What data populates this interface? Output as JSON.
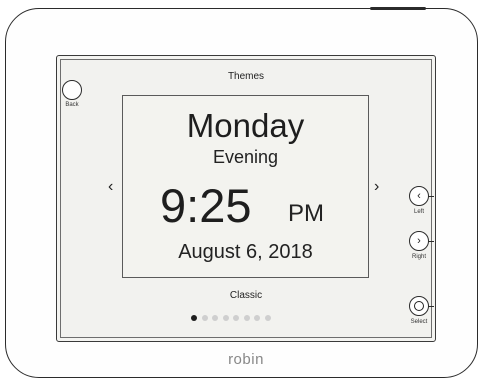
{
  "screen": {
    "title": "Themes",
    "day": "Monday",
    "period": "Evening",
    "time": "9:25",
    "ampm": "PM",
    "date": "August 6, 2018",
    "theme_name": "Classic",
    "prev_arrow": "‹",
    "next_arrow": "›",
    "page_indicator": {
      "total": 8,
      "current": 1
    }
  },
  "buttons": {
    "back": "Back",
    "left": "Left",
    "right": "Right",
    "select": "Select",
    "left_glyph": "‹",
    "right_glyph": "›"
  },
  "device": {
    "brand": "robin"
  },
  "colors": {
    "frame": "#2b2b2b",
    "screen": "#f2f2ef",
    "dot_active": "#1e1e1e",
    "dot_inactive": "#cfcfcf",
    "brand": "#888888"
  }
}
